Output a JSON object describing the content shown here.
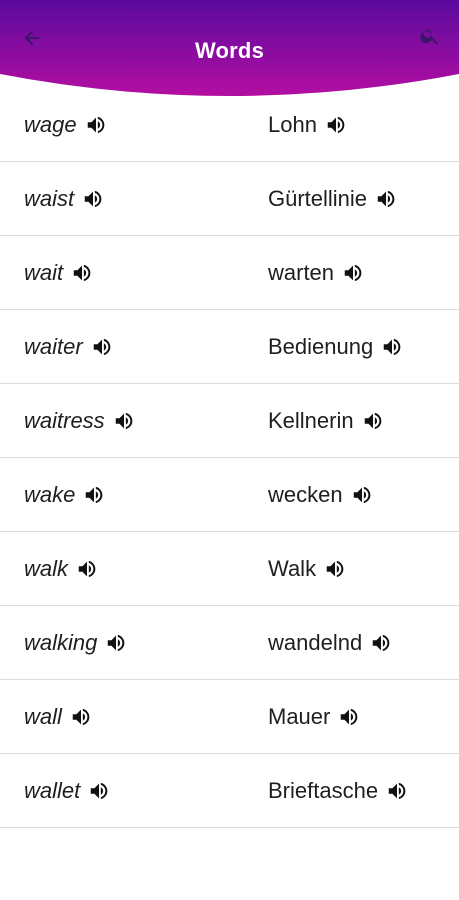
{
  "header": {
    "title": "Words",
    "gradient_start": "#6a0fa8",
    "gradient_end": "#b20fa0",
    "back_icon": "arrow-left-icon",
    "search_icon": "search-icon"
  },
  "speaker_icon": "volume-icon",
  "rows": [
    {
      "word": "wage",
      "translation": "Lohn"
    },
    {
      "word": "waist",
      "translation": "Gürtellinie"
    },
    {
      "word": "wait",
      "translation": "warten"
    },
    {
      "word": "waiter",
      "translation": "Bedienung"
    },
    {
      "word": "waitress",
      "translation": "Kellnerin"
    },
    {
      "word": "wake",
      "translation": "wecken"
    },
    {
      "word": "walk",
      "translation": "Walk"
    },
    {
      "word": "walking",
      "translation": "wandelnd"
    },
    {
      "word": "wall",
      "translation": "Mauer"
    },
    {
      "word": "wallet",
      "translation": "Brieftasche"
    }
  ]
}
